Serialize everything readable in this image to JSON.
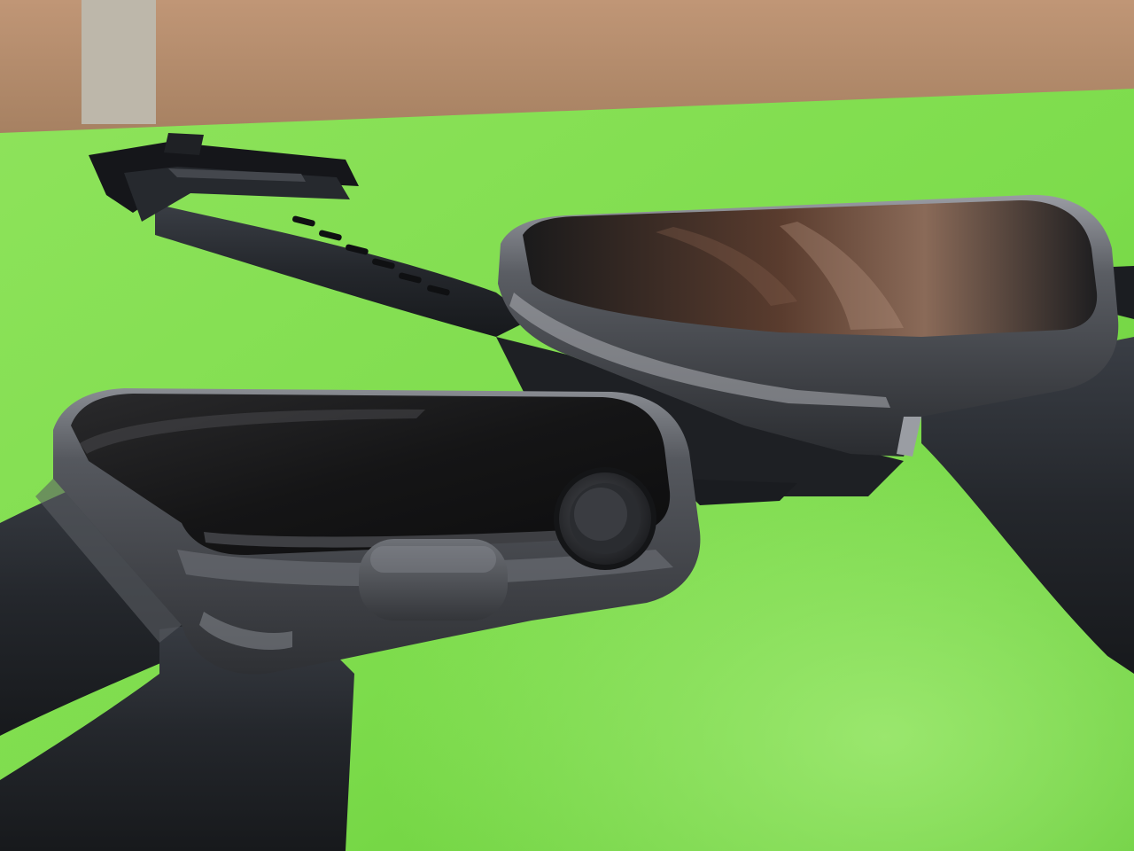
{
  "scene": {
    "subject": "two-smartwatches-on-green-surface",
    "colors": {
      "wall": "#b78c6c",
      "wall_shadow": "#8f6b4e",
      "surface": "#7ddc4c",
      "surface_light": "#a6ea78",
      "surface_dark": "#5cc530",
      "band": "#23262b",
      "band_edge": "#3a3e44",
      "case_metal": "#4a4c52",
      "case_highlight": "#8c8f96",
      "screen": "#161617",
      "screen_glare": "#6a4a3a",
      "marble": "#c9c4b8"
    },
    "objects": [
      "front-watch",
      "rear-watch",
      "black-silicone-band",
      "band-buckle",
      "digital-crown",
      "side-button"
    ]
  }
}
